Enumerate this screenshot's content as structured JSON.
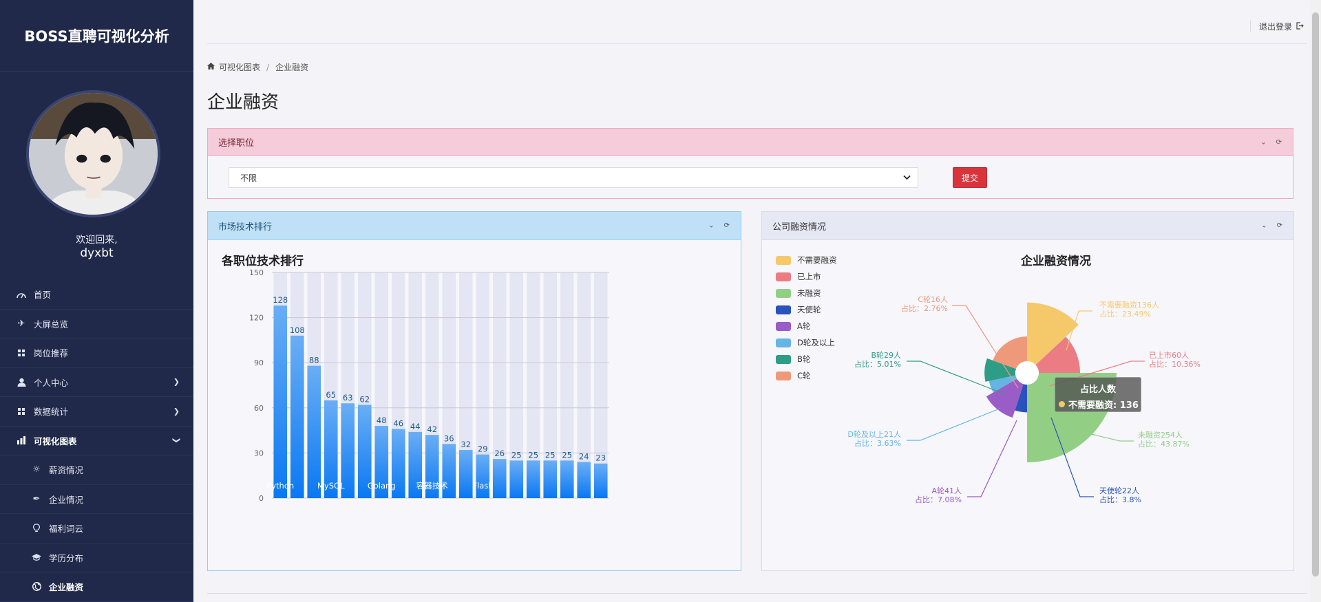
{
  "app": {
    "brand": "BOSS直聘可视化分析",
    "welcome": "欢迎回来,",
    "username": "dyxbt"
  },
  "sidebar": {
    "items": [
      {
        "label": "首页",
        "icon": "dashboard-icon"
      },
      {
        "label": "大屏总览",
        "icon": "airplane-icon"
      },
      {
        "label": "岗位推荐",
        "icon": "grid-icon"
      },
      {
        "label": "个人中心",
        "icon": "user-icon"
      },
      {
        "label": "数据统计",
        "icon": "grid-icon"
      },
      {
        "label": "可视化图表",
        "icon": "bar-chart-icon"
      }
    ],
    "subitems": [
      {
        "label": "薪资情况",
        "icon": "sun-icon"
      },
      {
        "label": "企业情况",
        "icon": "feather-icon"
      },
      {
        "label": "福利词云",
        "icon": "bulb-icon"
      },
      {
        "label": "学历分布",
        "icon": "graduation-cap-icon"
      },
      {
        "label": "企业融资",
        "icon": "globe-icon"
      }
    ]
  },
  "header": {
    "logout": "退出登录"
  },
  "breadcrumb": [
    "可视化图表",
    "企业融资"
  ],
  "page_title": "企业融资",
  "filter": {
    "title": "选择职位",
    "selected": "不限",
    "submit": "提交"
  },
  "left_panel": {
    "title": "市场技术排行"
  },
  "right_panel": {
    "title": "公司融资情况"
  },
  "tooltip": {
    "title": "占比人数",
    "row": "不需要融资: 136"
  },
  "colors": {
    "bar_top": "#6aaef5",
    "bar_bottom": "#0a78f2",
    "tooltip_dot": "#f5c96a"
  },
  "chart_data": [
    {
      "type": "bar",
      "title": "各职位技术排行",
      "categories": [
        "Python",
        "",
        "",
        "MySQL",
        "",
        "",
        "Golang",
        "",
        "",
        "容器技术",
        "",
        "",
        "Flask",
        "",
        "",
        "",
        "",
        "",
        "",
        "",
        ""
      ],
      "values": [
        128,
        108,
        88,
        65,
        63,
        62,
        48,
        46,
        44,
        42,
        36,
        32,
        29,
        26,
        25,
        25,
        25,
        25,
        24,
        23
      ],
      "y_ticks": [
        0,
        30,
        60,
        90,
        120,
        150
      ],
      "ylim": [
        0,
        150
      ],
      "visible_x_labels": [
        "Python",
        "MySQL",
        "Golang",
        "容器技术",
        "Flask"
      ],
      "grid": true
    },
    {
      "type": "pie",
      "title": "企业融资情况",
      "rose": true,
      "legend_position": "top-left",
      "slices": [
        {
          "name": "不需要融资",
          "value": 136,
          "pct": "23.49%",
          "label": "不需要融资136人",
          "pct_label": "占比：23.49%",
          "color": "#f5c96a"
        },
        {
          "name": "已上市",
          "value": 60,
          "pct": "10.36%",
          "label": "已上市60人",
          "pct_label": "占比：10.36%",
          "color": "#ec7c84"
        },
        {
          "name": "未融资",
          "value": 254,
          "pct": "43.87%",
          "label": "未融资254人",
          "pct_label": "占比：43.87%",
          "color": "#92cf85"
        },
        {
          "name": "天使轮",
          "value": 22,
          "pct": "3.8%",
          "label": "天使轮22人",
          "pct_label": "占比：3.8%",
          "color": "#2a52be"
        },
        {
          "name": "A轮",
          "value": 41,
          "pct": "7.08%",
          "label": "A轮41人",
          "pct_label": "占比：7.08%",
          "color": "#9a5cc6"
        },
        {
          "name": "D轮及以上",
          "value": 21,
          "pct": "3.63%",
          "label": "D轮及以上21人",
          "pct_label": "占比：3.63%",
          "color": "#64b4e4"
        },
        {
          "name": "B轮",
          "value": 29,
          "pct": "5.01%",
          "label": "B轮29人",
          "pct_label": "占比：5.01%",
          "color": "#2e9d86"
        },
        {
          "name": "C轮",
          "value": 16,
          "pct": "2.76%",
          "label": "C轮16人",
          "pct_label": "占比：2.76%",
          "color": "#ee9a7a"
        }
      ]
    }
  ]
}
